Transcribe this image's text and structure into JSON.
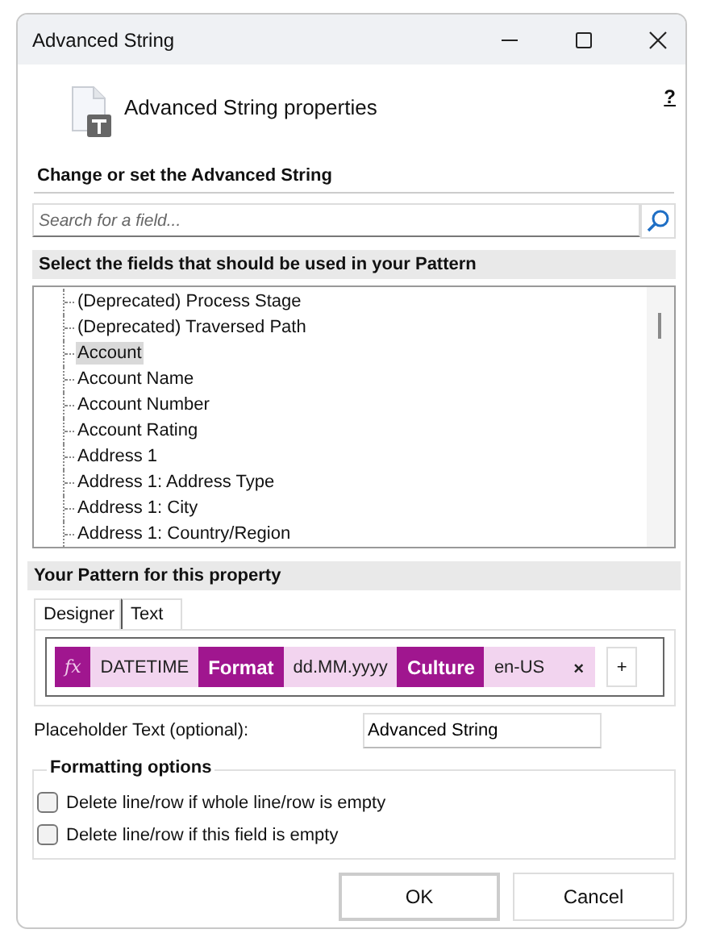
{
  "window": {
    "title": "Advanced String"
  },
  "header": {
    "title": "Advanced String properties",
    "help": "?"
  },
  "section_title": "Change or set the Advanced String",
  "search": {
    "placeholder": "Search for a field..."
  },
  "fields_header": "Select the fields that should be used in your Pattern",
  "fields": [
    {
      "label": "(Deprecated) Process Stage",
      "selected": false
    },
    {
      "label": "(Deprecated) Traversed Path",
      "selected": false
    },
    {
      "label": "Account",
      "selected": true
    },
    {
      "label": "Account Name",
      "selected": false
    },
    {
      "label": "Account Number",
      "selected": false
    },
    {
      "label": "Account Rating",
      "selected": false
    },
    {
      "label": "Address 1",
      "selected": false
    },
    {
      "label": "Address 1: Address Type",
      "selected": false
    },
    {
      "label": "Address 1: City",
      "selected": false
    },
    {
      "label": "Address 1: Country/Region",
      "selected": false
    }
  ],
  "pattern_header": "Your Pattern for this property",
  "tabs": [
    {
      "label": "Designer",
      "selected": true
    },
    {
      "label": "Text",
      "selected": false
    }
  ],
  "pattern": [
    {
      "kind": "function",
      "text": "fx"
    },
    {
      "kind": "value",
      "text": "DATETIME"
    },
    {
      "kind": "keyword",
      "text": "Format"
    },
    {
      "kind": "value",
      "text": "dd.MM.yyyy"
    },
    {
      "kind": "keyword",
      "text": "Culture"
    },
    {
      "kind": "value",
      "text": "en-US"
    }
  ],
  "pattern_remove": "×",
  "pattern_add": "+",
  "placeholder_field": {
    "label": "Placeholder Text (optional):",
    "value": "Advanced String"
  },
  "formatting": {
    "title": "Formatting options",
    "options": [
      {
        "label": "Delete line/row if whole line/row is empty",
        "checked": false
      },
      {
        "label": "Delete line/row if this field is empty",
        "checked": false
      }
    ]
  },
  "buttons": [
    {
      "label": "OK",
      "kind": "default"
    },
    {
      "label": "Cancel",
      "kind": "normal"
    }
  ]
}
